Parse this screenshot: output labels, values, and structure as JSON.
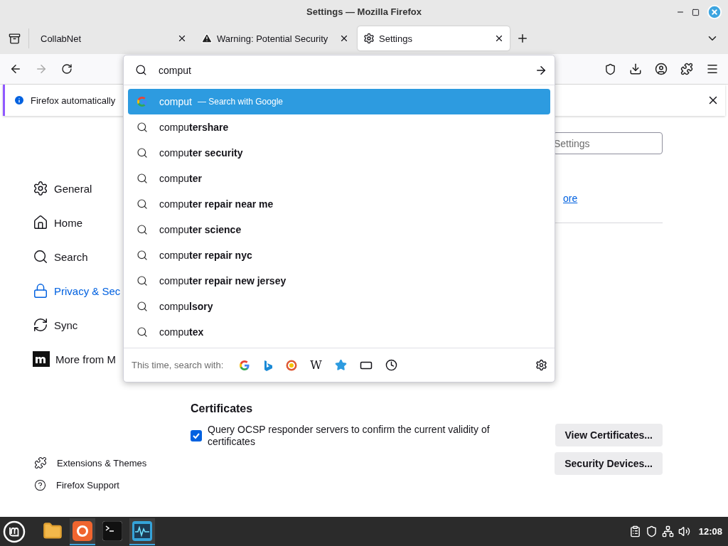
{
  "window": {
    "title": "Settings — Mozilla Firefox"
  },
  "tabs": [
    {
      "label": "CollabNet",
      "selected": false,
      "kind": "plain"
    },
    {
      "label": "Warning: Potential Security",
      "selected": false,
      "kind": "warning"
    },
    {
      "label": "Settings",
      "selected": true,
      "kind": "settings"
    }
  ],
  "address_bar": {
    "value": "comput"
  },
  "suggestions": [
    {
      "text": "comput",
      "hint": "— Search with Google",
      "kind": "engine",
      "selected": true
    },
    {
      "text": "compu**tershare**",
      "kind": "search",
      "selected": false
    },
    {
      "text": "compu**ter security**",
      "kind": "search",
      "selected": false
    },
    {
      "text": "compu**ter**",
      "kind": "search",
      "selected": false
    },
    {
      "text": "compu**ter repair near me**",
      "kind": "search",
      "selected": false
    },
    {
      "text": "compu**ter science**",
      "kind": "search",
      "selected": false
    },
    {
      "text": "compu**ter repair nyc**",
      "kind": "search",
      "selected": false
    },
    {
      "text": "compu**ter repair new jersey**",
      "kind": "search",
      "selected": false
    },
    {
      "text": "compu**lsory**",
      "kind": "search",
      "selected": false
    },
    {
      "text": "compu**tex**",
      "kind": "search",
      "selected": false
    }
  ],
  "one_off_search": {
    "label": "This time, search with:",
    "wikipedia_glyph": "W"
  },
  "notification": {
    "text": "Firefox automatically"
  },
  "find_field": {
    "placeholder": "Settings"
  },
  "learn_more_link": "ore",
  "sidebar": {
    "items": [
      {
        "label": "General",
        "selected": false,
        "kind": "general"
      },
      {
        "label": "Home",
        "selected": false,
        "kind": "home"
      },
      {
        "label": "Search",
        "selected": false,
        "kind": "search"
      },
      {
        "label": "Privacy & Sec",
        "selected": true,
        "kind": "privacy"
      },
      {
        "label": "Sync",
        "selected": false,
        "kind": "sync"
      },
      {
        "label": "More from M",
        "selected": false,
        "kind": "more"
      }
    ],
    "footer_links": [
      {
        "label": "Extensions & Themes",
        "kind": "extensions"
      },
      {
        "label": "Firefox Support",
        "kind": "support"
      }
    ]
  },
  "certificates": {
    "heading": "Certificates",
    "checkbox": {
      "label": "Query OCSP responder servers to confirm the current validity of certificates",
      "checked": true
    },
    "buttons": [
      "View Certificates...",
      "Security Devices..."
    ]
  },
  "taskbar": {
    "apps": [
      {
        "kind": "files",
        "selected": false
      },
      {
        "kind": "firefox",
        "selected": true
      },
      {
        "kind": "terminal",
        "selected": false
      },
      {
        "kind": "monitor",
        "selected": true
      }
    ],
    "clock": "12:08"
  }
}
